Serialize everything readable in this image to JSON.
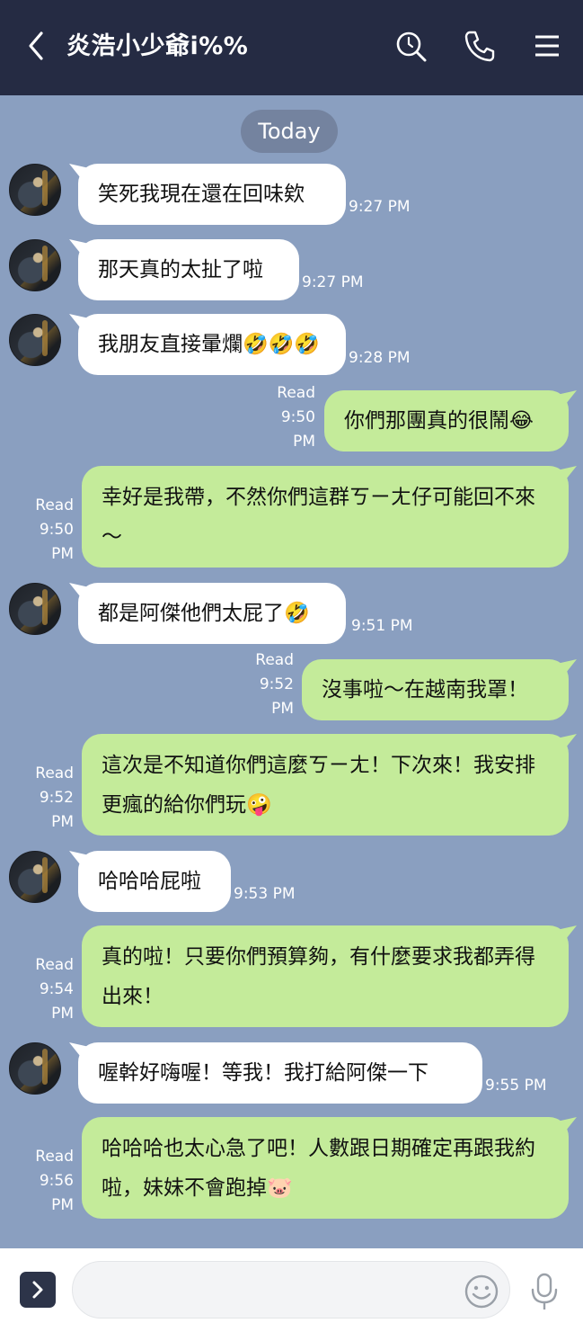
{
  "header": {
    "title": "炎浩小少爺i%%",
    "back_icon": "chevron-left-icon",
    "search_icon": "search-icon",
    "call_icon": "phone-icon",
    "menu_icon": "hamburger-menu-icon",
    "bg_color": "#252b43"
  },
  "chat": {
    "date_label": "Today",
    "bg_color": "#8a9fc0",
    "incoming_bubble_color": "#ffffff",
    "outgoing_bubble_color": "#c4eb9a",
    "messages": [
      {
        "dir": "in",
        "text": "笑死我現在還在回味欸",
        "time": "9:27 PM"
      },
      {
        "dir": "in",
        "text": "那天真的太扯了啦",
        "time": "9:27 PM"
      },
      {
        "dir": "in",
        "text": "我朋友直接暈爛🤣🤣🤣",
        "time": "9:28 PM"
      },
      {
        "dir": "out",
        "text": "你們那團真的很鬧😂",
        "read": "Read",
        "time_1": "9:50",
        "time_2": "PM"
      },
      {
        "dir": "out",
        "text": "幸好是我帶，不然你們這群ㄎㄧㄤ仔可能回不來～",
        "read": "Read",
        "time_1": "9:50",
        "time_2": "PM"
      },
      {
        "dir": "in",
        "text": "都是阿傑他們太屁了🤣",
        "time": "9:51 PM"
      },
      {
        "dir": "out",
        "text": "沒事啦～在越南我罩！",
        "read": "Read",
        "time_1": "9:52",
        "time_2": "PM"
      },
      {
        "dir": "out",
        "text": "這次是不知道你們這麼ㄎㄧㄤ！下次來！我安排更瘋的給你們玩🤪",
        "read": "Read",
        "time_1": "9:52",
        "time_2": "PM"
      },
      {
        "dir": "in",
        "text": "哈哈哈屁啦",
        "time": "9:53 PM"
      },
      {
        "dir": "out",
        "text": "真的啦！只要你們預算夠，有什麼要求我都弄得出來！",
        "read": "Read",
        "time_1": "9:54",
        "time_2": "PM"
      },
      {
        "dir": "in",
        "text": "喔幹好嗨喔！等我！我打給阿傑一下",
        "time": "9:55 PM"
      },
      {
        "dir": "out",
        "text": "哈哈哈也太心急了吧！人數跟日期確定再跟我約啦，妹妹不會跑掉🐷",
        "read": "Read",
        "time_1": "9:56",
        "time_2": "PM"
      }
    ]
  },
  "footer": {
    "expand_icon": "chevron-right-icon",
    "input_value": "",
    "input_placeholder": "",
    "emoji_icon": "smiley-icon",
    "mic_icon": "microphone-icon"
  }
}
